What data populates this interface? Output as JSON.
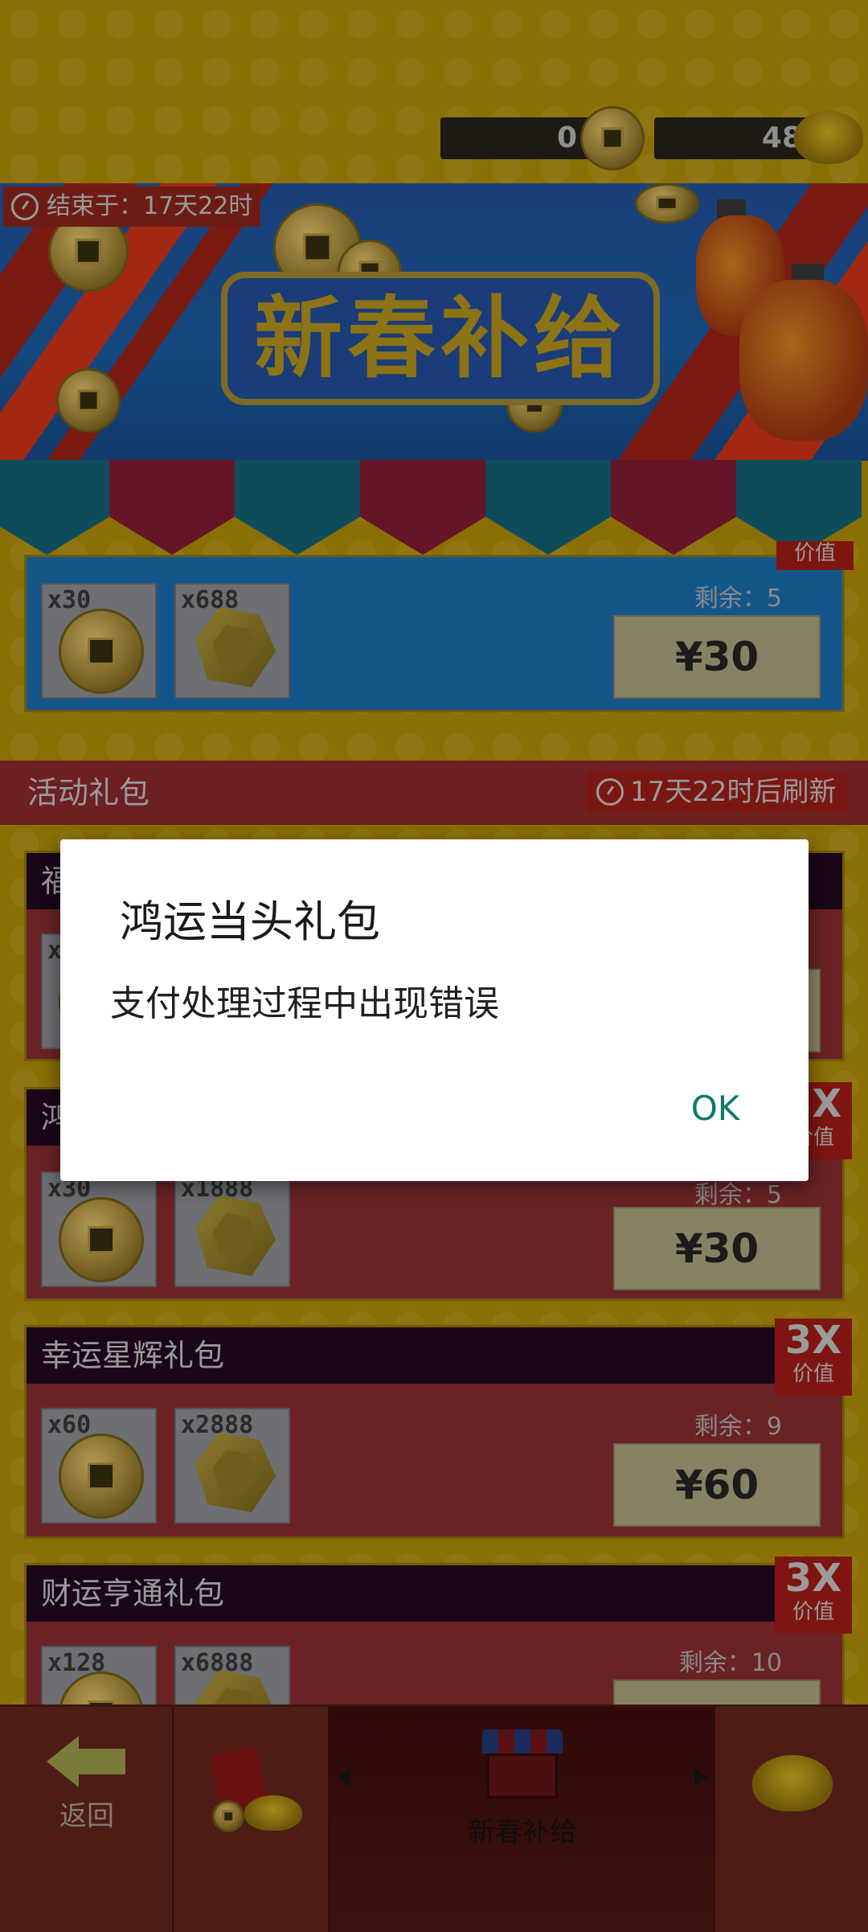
{
  "currency": {
    "coins": "0",
    "ingots": "48"
  },
  "banner": {
    "ends_label": "结束于：17天22时",
    "title": "新春补给"
  },
  "top_pack": {
    "items": [
      {
        "qty": "x30",
        "icon": "coin-icon"
      },
      {
        "qty": "x688",
        "icon": "gem-icon"
      }
    ],
    "remaining": "剩余：5",
    "price": "¥30",
    "value_small": "价值"
  },
  "section": {
    "title": "活动礼包",
    "refresh": "17天22时后刷新"
  },
  "packs": [
    {
      "title": "福",
      "items": [
        {
          "qty": "x",
          "icon": "coin-icon"
        }
      ],
      "remaining": "",
      "price": ""
    },
    {
      "title": "鸿",
      "items": [
        {
          "qty": "x30",
          "icon": "coin-icon"
        },
        {
          "qty": "x1888",
          "icon": "gem-icon"
        }
      ],
      "remaining": "剩余：5",
      "price": "¥30",
      "value_big": "3X",
      "value_small": "价值"
    },
    {
      "title": "幸运星辉礼包",
      "items": [
        {
          "qty": "x60",
          "icon": "coin-icon"
        },
        {
          "qty": "x2888",
          "icon": "gem-icon"
        }
      ],
      "remaining": "剩余：9",
      "price": "¥60",
      "value_big": "3X",
      "value_small": "价值"
    },
    {
      "title": "财运亨通礼包",
      "items": [
        {
          "qty": "x128",
          "icon": "coin-icon"
        },
        {
          "qty": "x6888",
          "icon": "gem-icon"
        }
      ],
      "remaining": "剩余：10",
      "price": "",
      "value_big": "3X",
      "value_small": "价值"
    }
  ],
  "dialog": {
    "title": "鸿运当头礼包",
    "message": "支付处理过程中出现错误",
    "ok": "OK"
  },
  "nav": {
    "back": "返回",
    "active": "新春补给"
  },
  "colors": {
    "dialog_ok": "#0a7a6a",
    "background": "#8a6f05"
  }
}
